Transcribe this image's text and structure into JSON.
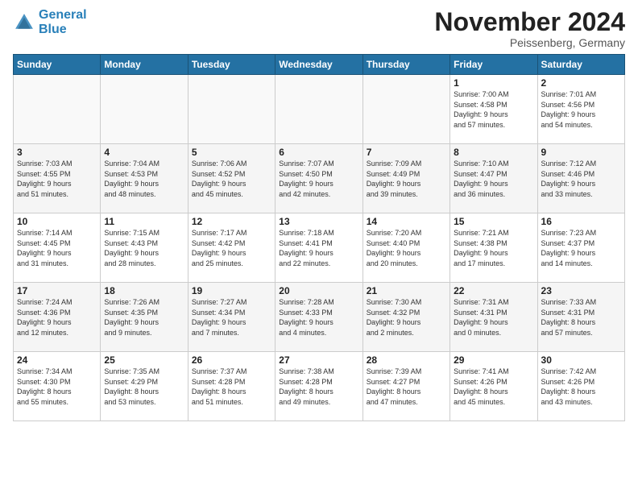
{
  "header": {
    "logo_line1": "General",
    "logo_line2": "Blue",
    "month_title": "November 2024",
    "location": "Peissenberg, Germany"
  },
  "weekdays": [
    "Sunday",
    "Monday",
    "Tuesday",
    "Wednesday",
    "Thursday",
    "Friday",
    "Saturday"
  ],
  "weeks": [
    [
      {
        "day": "",
        "info": ""
      },
      {
        "day": "",
        "info": ""
      },
      {
        "day": "",
        "info": ""
      },
      {
        "day": "",
        "info": ""
      },
      {
        "day": "",
        "info": ""
      },
      {
        "day": "1",
        "info": "Sunrise: 7:00 AM\nSunset: 4:58 PM\nDaylight: 9 hours\nand 57 minutes."
      },
      {
        "day": "2",
        "info": "Sunrise: 7:01 AM\nSunset: 4:56 PM\nDaylight: 9 hours\nand 54 minutes."
      }
    ],
    [
      {
        "day": "3",
        "info": "Sunrise: 7:03 AM\nSunset: 4:55 PM\nDaylight: 9 hours\nand 51 minutes."
      },
      {
        "day": "4",
        "info": "Sunrise: 7:04 AM\nSunset: 4:53 PM\nDaylight: 9 hours\nand 48 minutes."
      },
      {
        "day": "5",
        "info": "Sunrise: 7:06 AM\nSunset: 4:52 PM\nDaylight: 9 hours\nand 45 minutes."
      },
      {
        "day": "6",
        "info": "Sunrise: 7:07 AM\nSunset: 4:50 PM\nDaylight: 9 hours\nand 42 minutes."
      },
      {
        "day": "7",
        "info": "Sunrise: 7:09 AM\nSunset: 4:49 PM\nDaylight: 9 hours\nand 39 minutes."
      },
      {
        "day": "8",
        "info": "Sunrise: 7:10 AM\nSunset: 4:47 PM\nDaylight: 9 hours\nand 36 minutes."
      },
      {
        "day": "9",
        "info": "Sunrise: 7:12 AM\nSunset: 4:46 PM\nDaylight: 9 hours\nand 33 minutes."
      }
    ],
    [
      {
        "day": "10",
        "info": "Sunrise: 7:14 AM\nSunset: 4:45 PM\nDaylight: 9 hours\nand 31 minutes."
      },
      {
        "day": "11",
        "info": "Sunrise: 7:15 AM\nSunset: 4:43 PM\nDaylight: 9 hours\nand 28 minutes."
      },
      {
        "day": "12",
        "info": "Sunrise: 7:17 AM\nSunset: 4:42 PM\nDaylight: 9 hours\nand 25 minutes."
      },
      {
        "day": "13",
        "info": "Sunrise: 7:18 AM\nSunset: 4:41 PM\nDaylight: 9 hours\nand 22 minutes."
      },
      {
        "day": "14",
        "info": "Sunrise: 7:20 AM\nSunset: 4:40 PM\nDaylight: 9 hours\nand 20 minutes."
      },
      {
        "day": "15",
        "info": "Sunrise: 7:21 AM\nSunset: 4:38 PM\nDaylight: 9 hours\nand 17 minutes."
      },
      {
        "day": "16",
        "info": "Sunrise: 7:23 AM\nSunset: 4:37 PM\nDaylight: 9 hours\nand 14 minutes."
      }
    ],
    [
      {
        "day": "17",
        "info": "Sunrise: 7:24 AM\nSunset: 4:36 PM\nDaylight: 9 hours\nand 12 minutes."
      },
      {
        "day": "18",
        "info": "Sunrise: 7:26 AM\nSunset: 4:35 PM\nDaylight: 9 hours\nand 9 minutes."
      },
      {
        "day": "19",
        "info": "Sunrise: 7:27 AM\nSunset: 4:34 PM\nDaylight: 9 hours\nand 7 minutes."
      },
      {
        "day": "20",
        "info": "Sunrise: 7:28 AM\nSunset: 4:33 PM\nDaylight: 9 hours\nand 4 minutes."
      },
      {
        "day": "21",
        "info": "Sunrise: 7:30 AM\nSunset: 4:32 PM\nDaylight: 9 hours\nand 2 minutes."
      },
      {
        "day": "22",
        "info": "Sunrise: 7:31 AM\nSunset: 4:31 PM\nDaylight: 9 hours\nand 0 minutes."
      },
      {
        "day": "23",
        "info": "Sunrise: 7:33 AM\nSunset: 4:31 PM\nDaylight: 8 hours\nand 57 minutes."
      }
    ],
    [
      {
        "day": "24",
        "info": "Sunrise: 7:34 AM\nSunset: 4:30 PM\nDaylight: 8 hours\nand 55 minutes."
      },
      {
        "day": "25",
        "info": "Sunrise: 7:35 AM\nSunset: 4:29 PM\nDaylight: 8 hours\nand 53 minutes."
      },
      {
        "day": "26",
        "info": "Sunrise: 7:37 AM\nSunset: 4:28 PM\nDaylight: 8 hours\nand 51 minutes."
      },
      {
        "day": "27",
        "info": "Sunrise: 7:38 AM\nSunset: 4:28 PM\nDaylight: 8 hours\nand 49 minutes."
      },
      {
        "day": "28",
        "info": "Sunrise: 7:39 AM\nSunset: 4:27 PM\nDaylight: 8 hours\nand 47 minutes."
      },
      {
        "day": "29",
        "info": "Sunrise: 7:41 AM\nSunset: 4:26 PM\nDaylight: 8 hours\nand 45 minutes."
      },
      {
        "day": "30",
        "info": "Sunrise: 7:42 AM\nSunset: 4:26 PM\nDaylight: 8 hours\nand 43 minutes."
      }
    ]
  ]
}
